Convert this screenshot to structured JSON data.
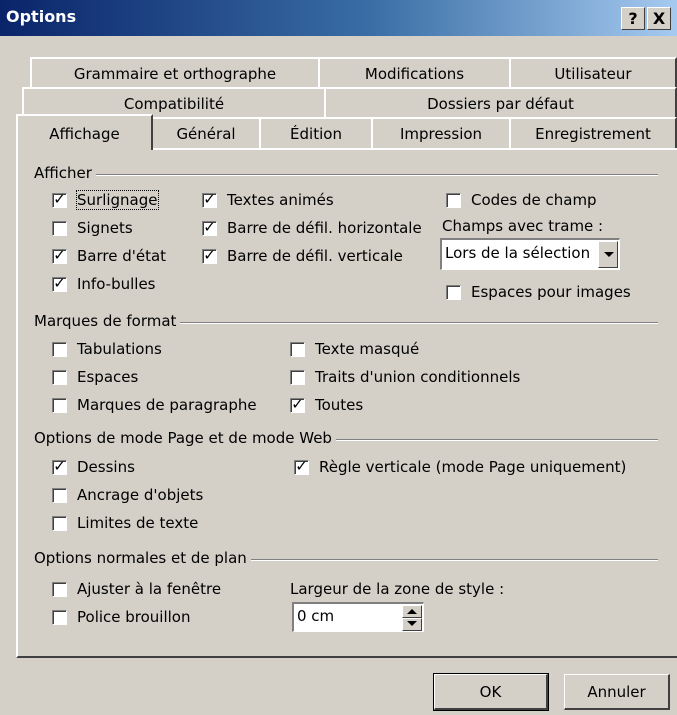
{
  "window": {
    "title": "Options",
    "help_glyph": "?",
    "close_glyph": "X"
  },
  "tabs": {
    "row1": [
      "Grammaire et orthographe",
      "Modifications",
      "Utilisateur"
    ],
    "row2": [
      "Compatibilité",
      "Dossiers par défaut"
    ],
    "row3": [
      "Affichage",
      "Général",
      "Édition",
      "Impression",
      "Enregistrement"
    ],
    "active": "Affichage"
  },
  "afficher": {
    "label": "Afficher",
    "items": [
      {
        "label": "Surlignage",
        "checked": true
      },
      {
        "label": "Signets",
        "checked": false
      },
      {
        "label": "Barre d'état",
        "checked": true
      },
      {
        "label": "Info-bulles",
        "checked": true
      },
      {
        "label": "Textes animés",
        "checked": true
      },
      {
        "label": "Barre de défil. horizontale",
        "checked": true
      },
      {
        "label": "Barre de défil. verticale",
        "checked": true
      },
      {
        "label": "Codes de champ",
        "checked": false
      },
      {
        "label": "Espaces pour images",
        "checked": false
      }
    ],
    "champs_label": "Champs avec trame :",
    "champs_value": "Lors de la sélection"
  },
  "marques": {
    "label": "Marques de format",
    "items": [
      {
        "label": "Tabulations",
        "checked": false
      },
      {
        "label": "Espaces",
        "checked": false
      },
      {
        "label": "Marques de paragraphe",
        "checked": false
      },
      {
        "label": "Texte masqué",
        "checked": false
      },
      {
        "label": "Traits d'union conditionnels",
        "checked": false
      },
      {
        "label": "Toutes",
        "checked": true
      }
    ]
  },
  "page_web": {
    "label": "Options de mode Page et de mode Web",
    "items": [
      {
        "label": "Dessins",
        "checked": true
      },
      {
        "label": "Ancrage d'objets",
        "checked": false
      },
      {
        "label": "Limites de texte",
        "checked": false
      },
      {
        "label": "Règle verticale (mode Page uniquement)",
        "checked": true
      }
    ]
  },
  "normales": {
    "label": "Options normales et de plan",
    "items": [
      {
        "label": "Ajuster à la fenêtre",
        "checked": false
      },
      {
        "label": "Police brouillon",
        "checked": false
      }
    ],
    "largeur_label": "Largeur de la zone de style :",
    "largeur_value": "0 cm"
  },
  "buttons": {
    "ok": "OK",
    "cancel": "Annuler"
  }
}
